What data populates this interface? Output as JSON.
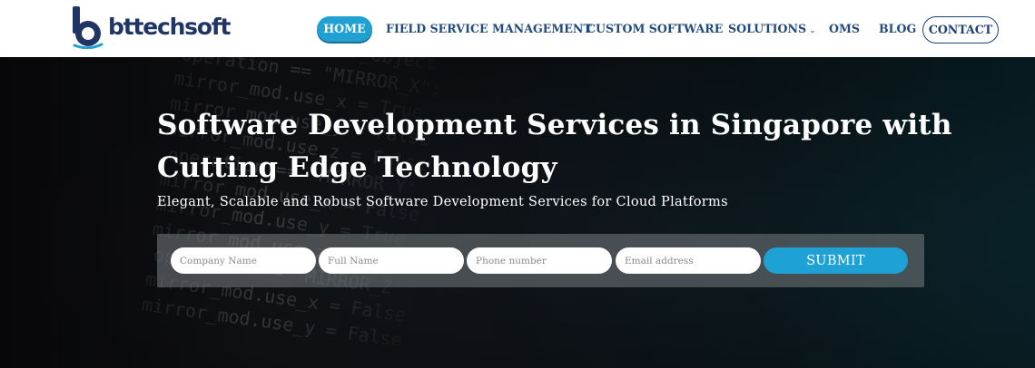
{
  "brand": {
    "logo_text": "bttechsoft",
    "logo_letter": "b"
  },
  "nav": {
    "home": "HOME",
    "field_service": "FIELD SERVICE MANAGEMENT",
    "custom_software": "CUSTOM SOFTWARE",
    "solutions": "SOLUTIONS",
    "solutions_chevron": "⌄",
    "oms": "OMS",
    "blog": "BLOG",
    "contact": "CONTACT"
  },
  "hero": {
    "title": "Software Development Services in Singapore with Cutting Edge Technology",
    "subtitle": "Elegant, Scalable and Robust Software Development Services for Cloud Platforms"
  },
  "form": {
    "company_placeholder": "Company Name",
    "name_placeholder": "Full Name",
    "phone_placeholder": "Phone number",
    "email_placeholder": "Email address",
    "submit_label": "SUBMIT"
  },
  "colors": {
    "accent": "#21a0d2",
    "brand_navy": "#1f3566",
    "nav_text": "#1f4a7a"
  }
}
